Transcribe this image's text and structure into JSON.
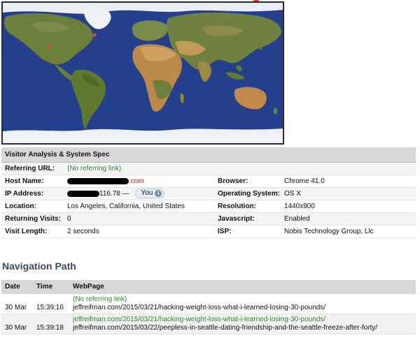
{
  "colors": {
    "header_bg": "#d7d7d7",
    "referral_green": "#2e8a2e",
    "host_red": "#b8281e",
    "ocean": "#243f8c",
    "land": "#6b7f3a",
    "marker": "#e0442d"
  },
  "map": {
    "icon": "world-map"
  },
  "visitor": {
    "title": "Visitor Analysis & System Spec",
    "referring_url_label": "Referring URL:",
    "referring_url_value": "(No referring link)",
    "host_label": "Host Name:",
    "host_suffix": ".com",
    "ip_label": "IP Address:",
    "ip_suffix": "116.78 —",
    "you_label": "You",
    "location_label": "Location:",
    "location_value": "Los Angeles, California, United States",
    "returning_label": "Returning Visits:",
    "returning_value": "0",
    "length_label": "Visit Length:",
    "length_value": "2 seconds",
    "browser_label": "Browser:",
    "browser_value": "Chrome 41.0",
    "os_label": "Operating System:",
    "os_value": "OS X",
    "resolution_label": "Resolution:",
    "resolution_value": "1440x900",
    "js_label": "Javascript:",
    "js_value": "Enabled",
    "isp_label": "ISP:",
    "isp_value": "Nobis Technology Group, Llc"
  },
  "navigation": {
    "title": "Navigation Path",
    "col_date": "Date",
    "col_time": "Time",
    "col_page": "WebPage",
    "rows": [
      {
        "date": "30 Mar",
        "time": "15:39:16",
        "referrer": "(No referring link)",
        "page": "jeffreifman.com/2015/03/21/hacking-weight-loss-what-i-learned-losing-30-pounds/"
      },
      {
        "date": "30 Mar",
        "time": "15:39:18",
        "referrer": "jeffreifman.com/2015/03/21/hacking-weight-loss-what-i-learned-losing-30-pounds/",
        "page": "jeffreifman.com/2015/03/22/peepless-in-seattle-dating-friendship-and-the-seattle-freeze-after-forty/"
      }
    ]
  }
}
